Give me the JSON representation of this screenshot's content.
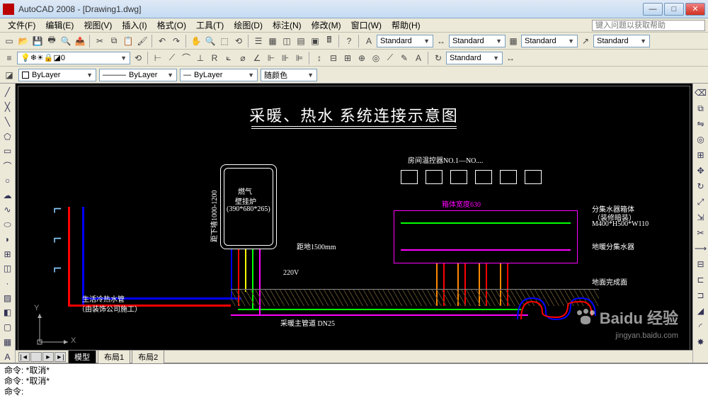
{
  "titlebar": {
    "title": "AutoCAD 2008 - [Drawing1.dwg]",
    "min": "—",
    "max": "□",
    "close": "✕"
  },
  "menubar": {
    "items": [
      "文件(F)",
      "编辑(E)",
      "视图(V)",
      "插入(I)",
      "格式(O)",
      "工具(T)",
      "绘图(D)",
      "标注(N)",
      "修改(M)",
      "窗口(W)",
      "帮助(H)"
    ],
    "help_placeholder": "键入问题以获取帮助"
  },
  "toolbars": {
    "styles": {
      "text_style": "Standard",
      "dim_style": "Standard",
      "table_style": "Standard",
      "mleader_style": "Standard",
      "dim_style2": "Standard"
    }
  },
  "layer_row": {
    "layer_dropdown": "0"
  },
  "prop_row": {
    "color": "ByLayer",
    "linetype": "ByLayer",
    "lineweight": "ByLayer",
    "plotstyle": "随颜色"
  },
  "drawing": {
    "title": "采暖、热水  系统连接示意图",
    "thermostat_label": "房间温控器NO.1—NO....",
    "boiler_label1": "燃气",
    "boiler_label2": "壁挂炉",
    "boiler_label3": "(390*680*265)",
    "left_pipe_label1": "生活冷热水管",
    "left_pipe_label2": "（由装饰公司施工）",
    "main_pipe_label": "采暖主管道   DN25",
    "manifold_label": "地暖分集水器",
    "floor_label": "地面完成面",
    "box_dim_label": "M400*H500*W110",
    "box_type_label1": "分集水器箱体",
    "box_type_label2": "（装修暗装）",
    "width_label": "箱体宽度630",
    "dist_label": "距地1500mm",
    "height_label": "距下墙1000-1200",
    "voltage_label": "220V",
    "ucs_x": "X",
    "ucs_y": "Y"
  },
  "model_tabs": {
    "nav": [
      "|◄",
      "◄",
      "►",
      "►|"
    ],
    "tabs": [
      "模型",
      "布局1",
      "布局2"
    ]
  },
  "command": {
    "line1": "命令:  *取消*",
    "line2": "命令:  *取消*",
    "prompt": "命令:"
  },
  "watermark": {
    "text": "Baidu 经验",
    "sub": "jingyan.baidu.com"
  }
}
